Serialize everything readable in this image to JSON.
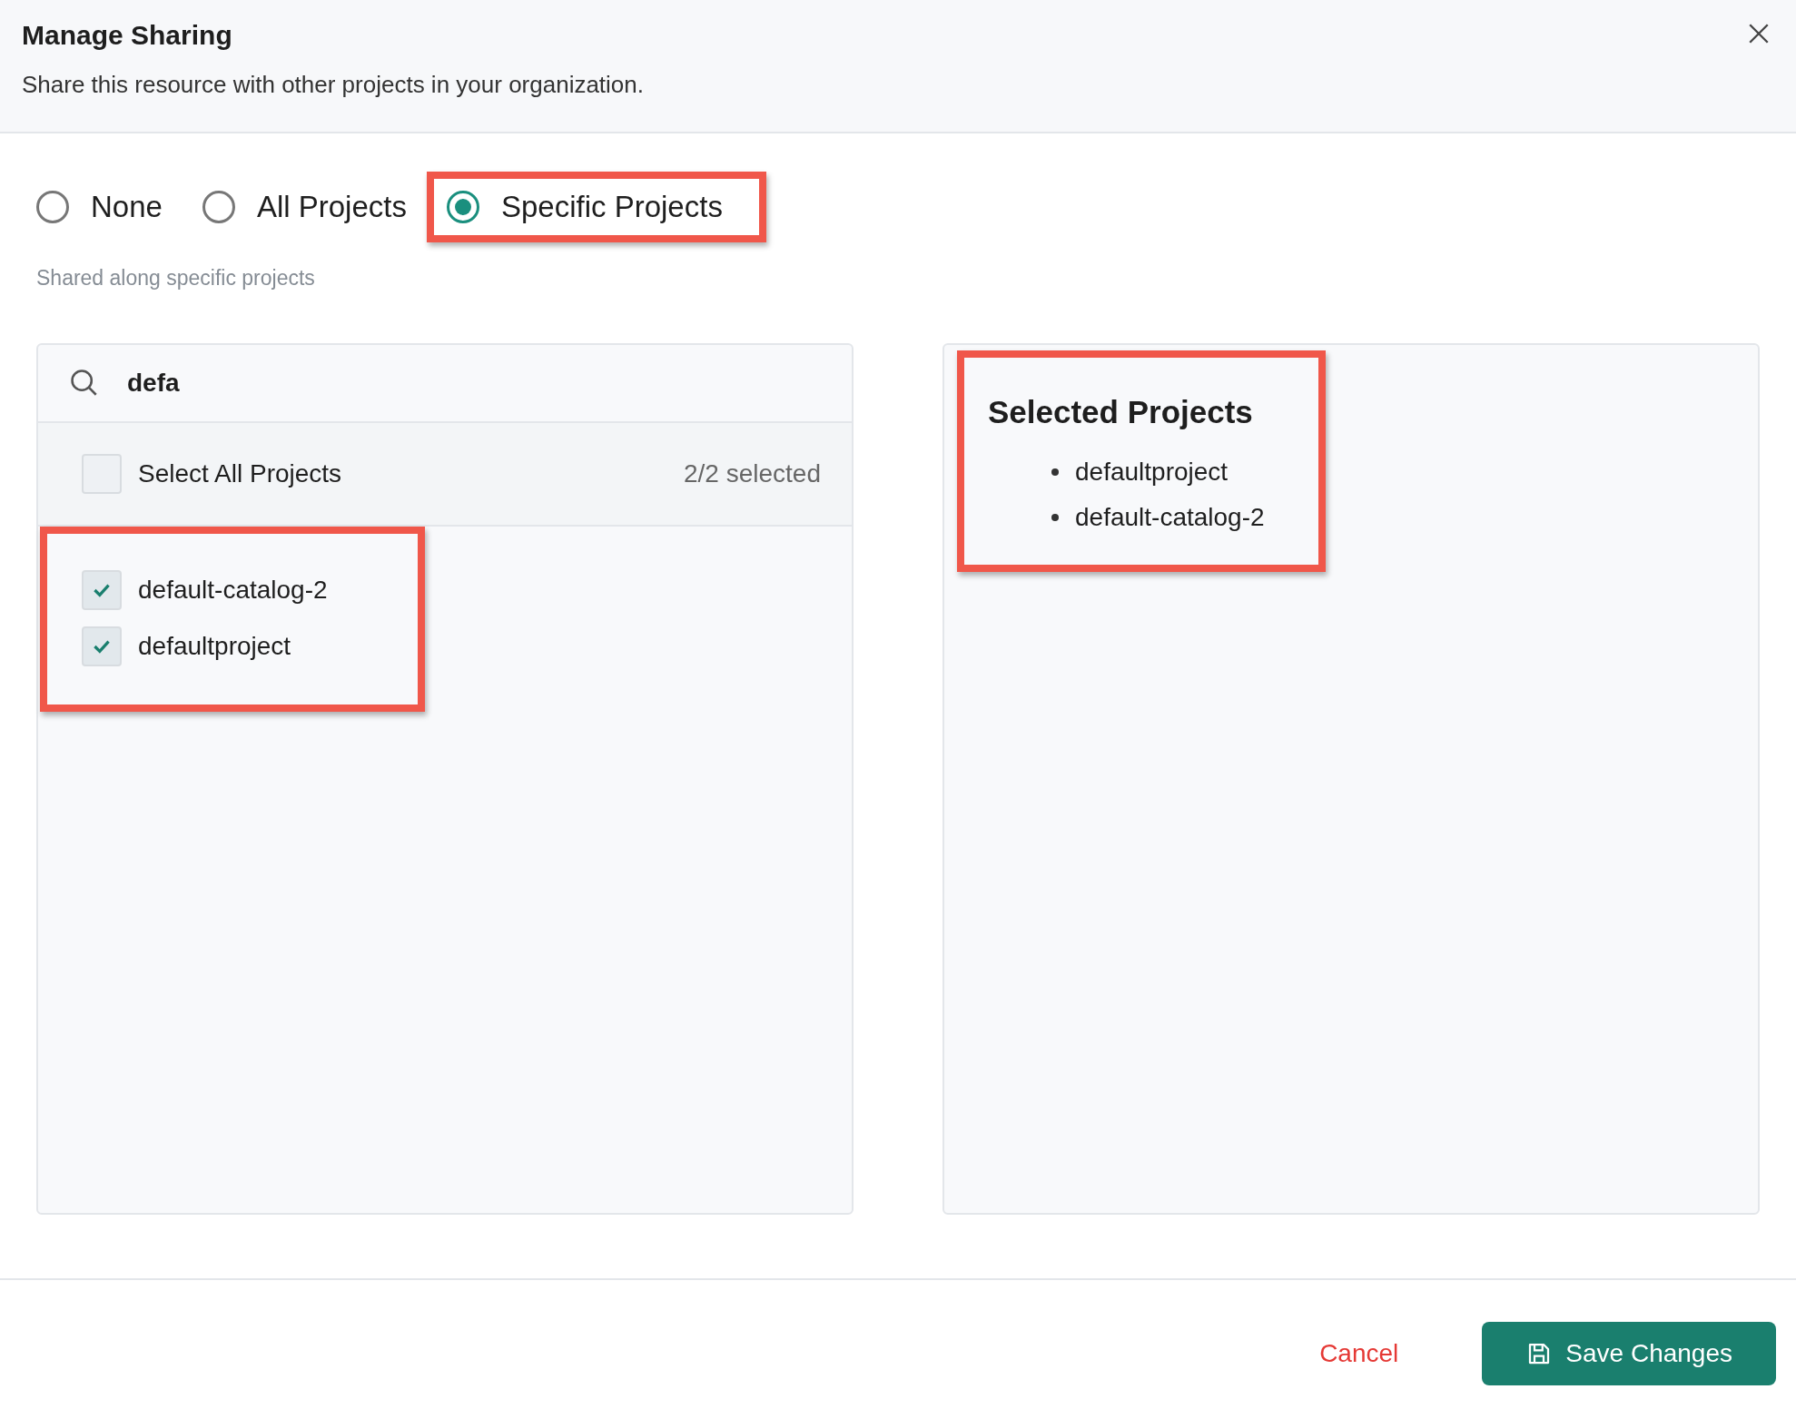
{
  "dialog": {
    "title": "Manage Sharing",
    "subtitle": "Share this resource with other projects in your organization."
  },
  "sharing_options": [
    {
      "label": "None",
      "selected": false,
      "highlighted": false
    },
    {
      "label": "All Projects",
      "selected": false,
      "highlighted": false
    },
    {
      "label": "Specific Projects",
      "selected": true,
      "highlighted": true
    }
  ],
  "helper_text": "Shared along specific projects",
  "project_picker": {
    "search": {
      "value": "defa"
    },
    "select_all": {
      "label": "Select All Projects",
      "checked": false,
      "count": "2/2 selected"
    },
    "items_highlighted": true,
    "items": [
      {
        "label": "default-catalog-2",
        "checked": true
      },
      {
        "label": "defaultproject",
        "checked": true
      }
    ]
  },
  "selected_panel": {
    "title": "Selected Projects",
    "highlighted": true,
    "items": [
      "defaultproject",
      "default-catalog-2"
    ]
  },
  "buttons": {
    "cancel": "Cancel",
    "save": "Save Changes"
  }
}
